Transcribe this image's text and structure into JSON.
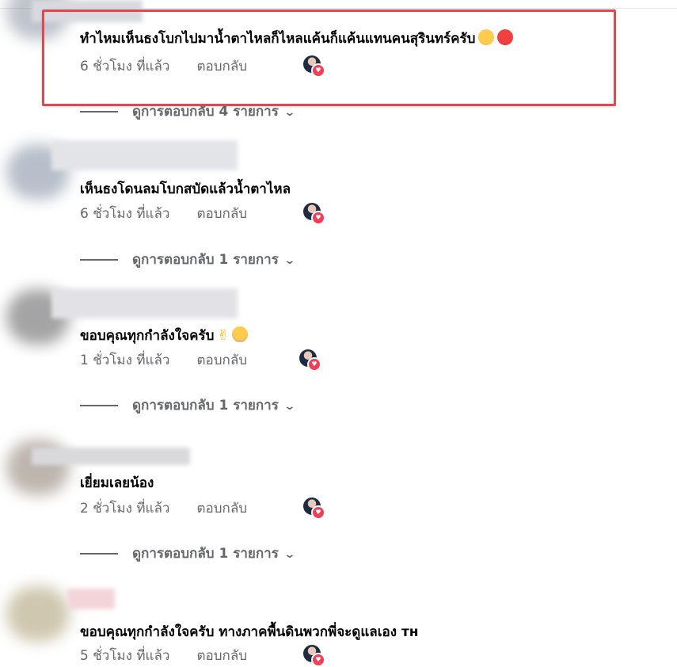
{
  "comments": [
    {
      "text": "ทำไหมเห็นธงโบกไปมาน้ำตาไหลก็ไหลแค้นก็แค้นแทนคนสุรินทร์ครับ",
      "emojis": [
        "pleading-face-emoji",
        "angry-face-emoji"
      ],
      "time": "6 ชั่วโมง ที่แล้ว",
      "reply_label": "ตอบกลับ",
      "replies_label": "ดูการตอบกลับ 4 รายการ",
      "highlighted": true
    },
    {
      "text": "เห็นธงโดนลมโบกสบัดแล้วน้ำตาไหล",
      "time": "6 ชั่วโมง ที่แล้ว",
      "reply_label": "ตอบกลับ",
      "replies_label": "ดูการตอบกลับ 1 รายการ"
    },
    {
      "text": "ขอบคุณทุกกำลังใจครับ",
      "emojis": [
        "victory-hand-emoji",
        "smiling-face-with-hearts-emoji"
      ],
      "time": "1 ชั่วโมง ที่แล้ว",
      "reply_label": "ตอบกลับ",
      "replies_label": "ดูการตอบกลับ 1 รายการ"
    },
    {
      "text": "เยี่ยมเลยน้อง",
      "time": "2 ชั่วโมง ที่แล้ว",
      "reply_label": "ตอบกลับ",
      "replies_label": "ดูการตอบกลับ 1 รายการ"
    },
    {
      "text": "ขอบคุณทุกกำลังใจครับ ทางภาคพื้นดินพวกพี่จะดูแลเอง ᴛʜ",
      "time": "5 ชั่วโมง ที่แล้ว",
      "reply_label": "ตอบกลับ"
    }
  ],
  "colors": {
    "highlight_border": "#e0474f",
    "meta_text": "#65676b",
    "heart_badge": "#f33e58"
  },
  "icons": [
    "chevron-down-icon",
    "heart-reaction-icon"
  ]
}
